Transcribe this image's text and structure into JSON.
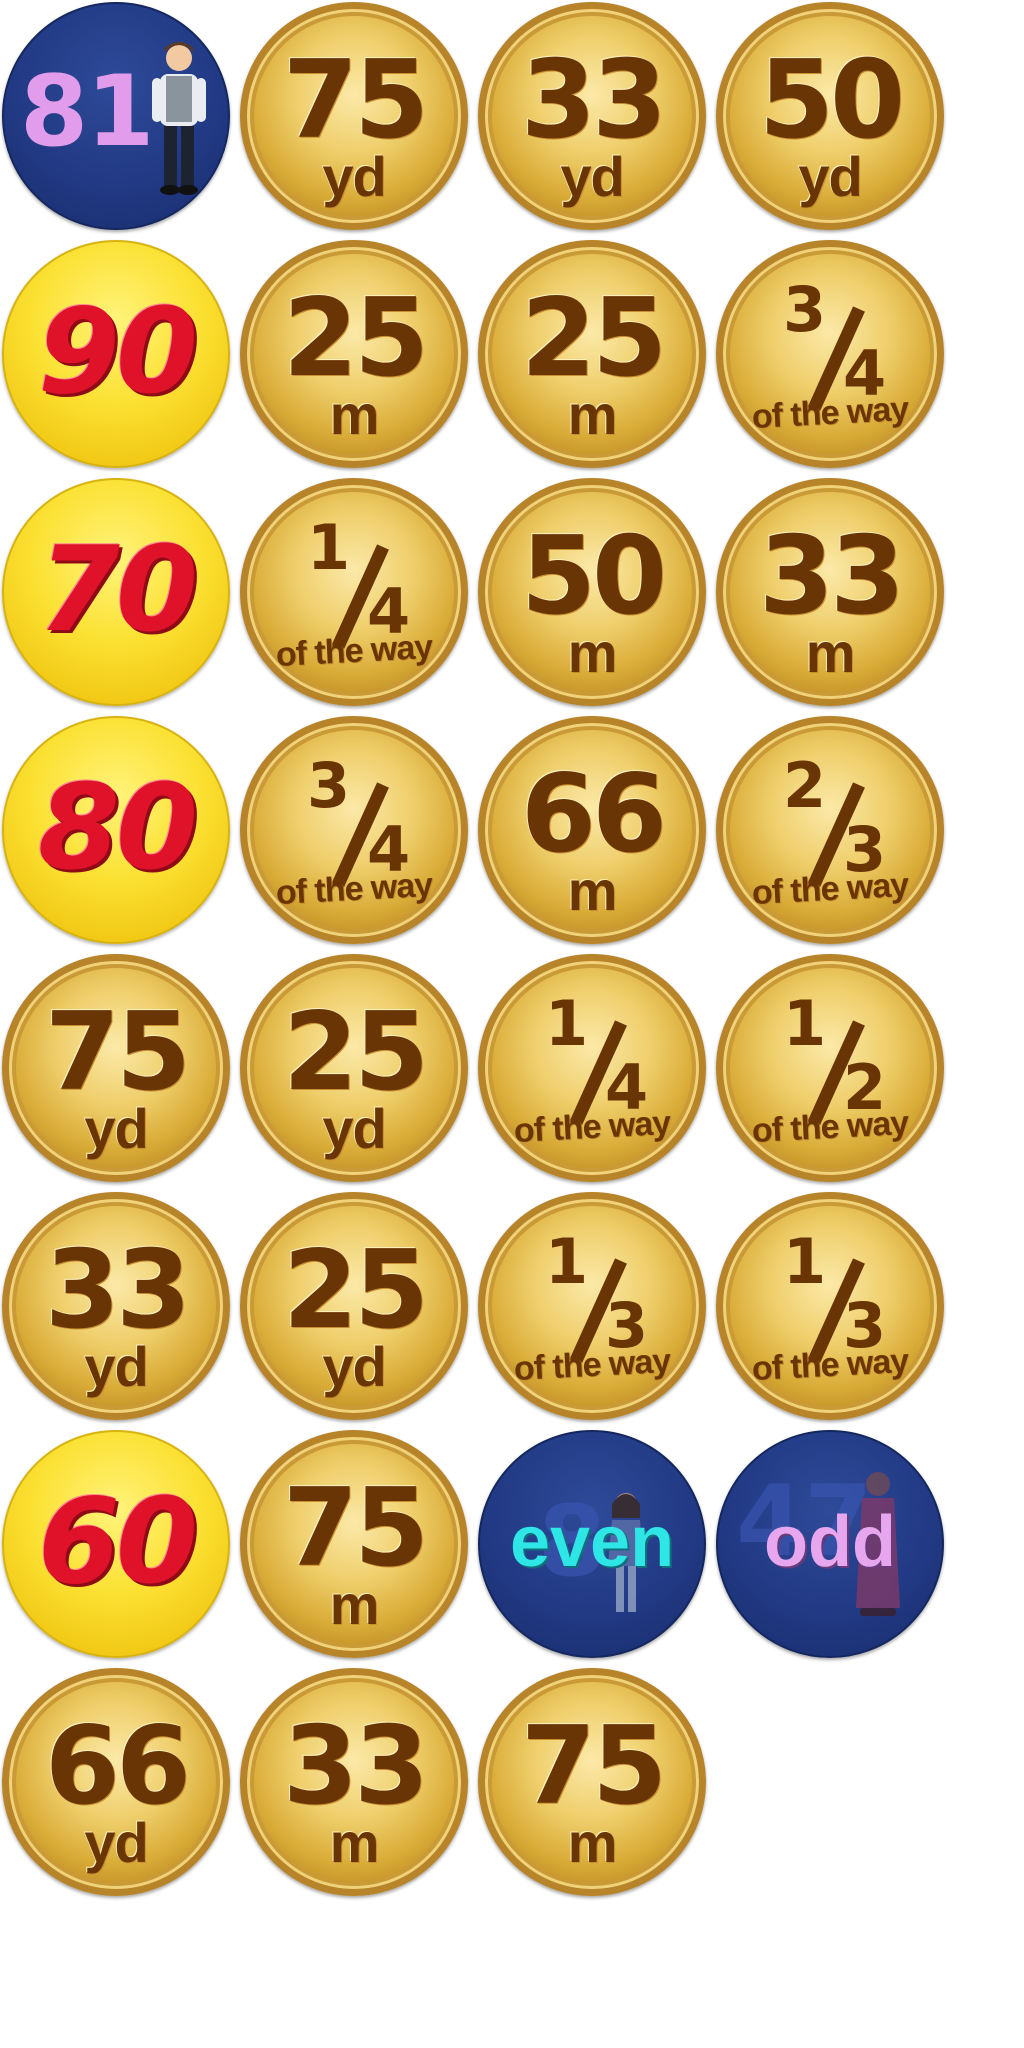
{
  "colors": {
    "gold_text": "#6a3505",
    "red_number": "#e0122a",
    "yellow_coin": "#fbe133",
    "blue_coin": "#223a85",
    "lilac_text": "#e29cec",
    "cyan_text": "#2ee6e6"
  },
  "coins": {
    "r1c1": {
      "number": "81",
      "figure": "boy-icon"
    },
    "r1c2": {
      "number": "75",
      "unit": "yd"
    },
    "r1c3": {
      "number": "33",
      "unit": "yd"
    },
    "r1c4": {
      "number": "50",
      "unit": "yd"
    },
    "r2c1": {
      "number": "90"
    },
    "r2c2": {
      "number": "25",
      "unit": "m"
    },
    "r2c3": {
      "number": "25",
      "unit": "m"
    },
    "r2c4": {
      "num": "3",
      "den": "4",
      "caption": "of the way"
    },
    "r3c1": {
      "number": "70"
    },
    "r3c2": {
      "num": "1",
      "den": "4",
      "caption": "of the way"
    },
    "r3c3": {
      "number": "50",
      "unit": "m"
    },
    "r3c4": {
      "number": "33",
      "unit": "m"
    },
    "r4c1": {
      "number": "80"
    },
    "r4c2": {
      "num": "3",
      "den": "4",
      "caption": "of the way"
    },
    "r4c3": {
      "number": "66",
      "unit": "m"
    },
    "r4c4": {
      "num": "2",
      "den": "3",
      "caption": "of the way"
    },
    "r5c1": {
      "number": "75",
      "unit": "yd"
    },
    "r5c2": {
      "number": "25",
      "unit": "yd"
    },
    "r5c3": {
      "num": "1",
      "den": "4",
      "caption": "of the way"
    },
    "r5c4": {
      "num": "1",
      "den": "2",
      "caption": "of the way"
    },
    "r6c1": {
      "number": "33",
      "unit": "yd"
    },
    "r6c2": {
      "number": "25",
      "unit": "yd"
    },
    "r6c3": {
      "num": "1",
      "den": "3",
      "caption": "of the way"
    },
    "r6c4": {
      "num": "1",
      "den": "3",
      "caption": "of the way"
    },
    "r7c1": {
      "number": "60"
    },
    "r7c2": {
      "number": "75",
      "unit": "m"
    },
    "r7c3": {
      "word": "even",
      "ghost": "8",
      "figure": "girl-icon"
    },
    "r7c4": {
      "word": "odd",
      "ghost": "47",
      "figure": "woman-icon"
    },
    "r8c1": {
      "number": "66",
      "unit": "yd"
    },
    "r8c2": {
      "number": "33",
      "unit": "m"
    },
    "r8c3": {
      "number": "75",
      "unit": "m"
    }
  }
}
